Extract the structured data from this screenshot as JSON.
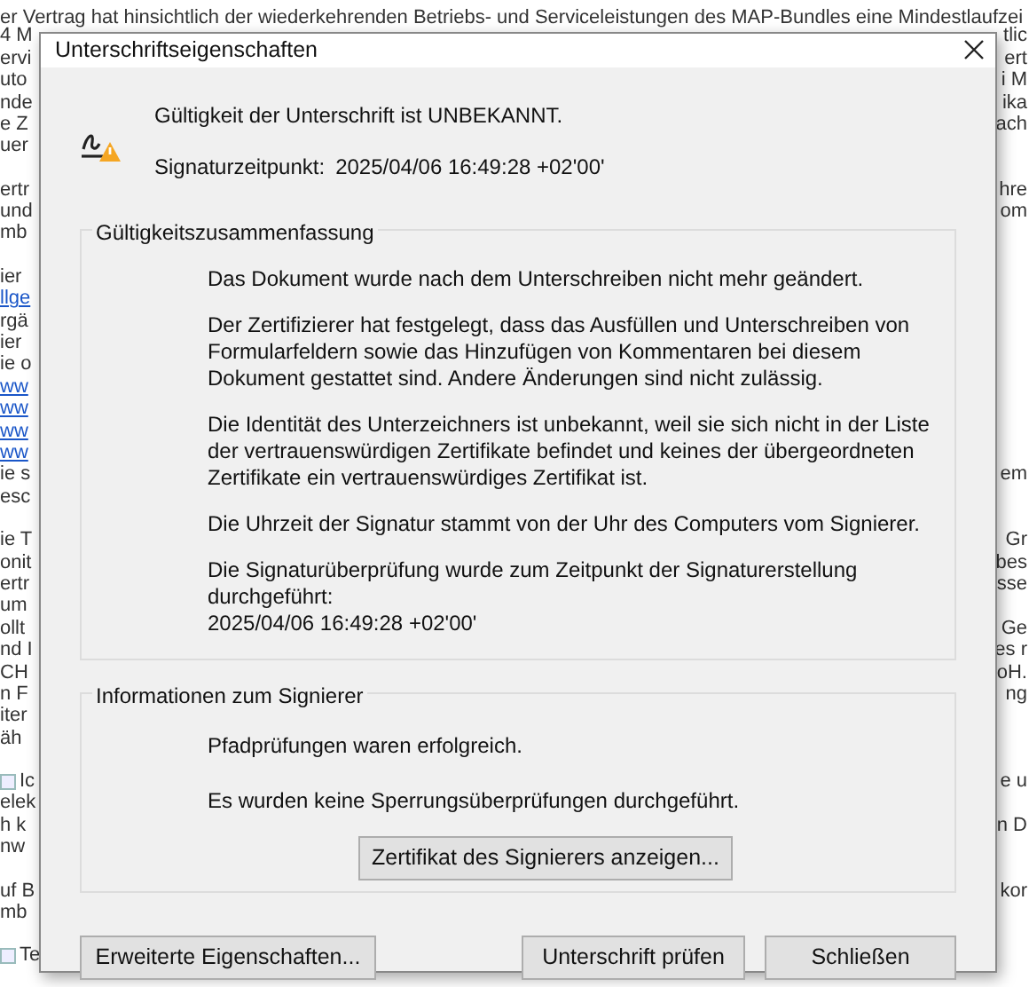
{
  "document": {
    "top_line": "er Vertrag hat hinsichtlich der wiederkehrenden Betriebs- und Serviceleistungen des MAP-Bundles eine Mindestlaufzei",
    "paragraphs": [
      {
        "lines": [
          {
            "left": "4 M",
            "right": "tlic"
          },
          {
            "left": "ervi",
            "right": "ert"
          },
          {
            "left": "uto",
            "right": "i M"
          },
          {
            "left": "nde",
            "right": "ika"
          },
          {
            "left": "e Z",
            "right": "ach"
          },
          {
            "left": "uer"
          }
        ]
      },
      {
        "lines": [
          {
            "left": "ertr",
            "right": "hre"
          },
          {
            "left": "und",
            "right": "om"
          },
          {
            "left": "mb"
          }
        ]
      },
      {
        "lines": [
          {
            "left": "ier"
          },
          {
            "left": "llge",
            "link": true
          },
          {
            "left": "rgä"
          },
          {
            "left": "ier"
          },
          {
            "left": "ie o"
          },
          {
            "left": "ww",
            "link": true
          },
          {
            "left": "ww",
            "link": true
          },
          {
            "left": "ww",
            "link": true
          },
          {
            "left": "ww",
            "link": true
          },
          {
            "left": "ie s",
            "right": "em"
          },
          {
            "left": "esc"
          }
        ]
      },
      {
        "lines": [
          {
            "left": "ie T",
            "right": "Gr"
          },
          {
            "left": "onit",
            "right": "bes"
          },
          {
            "left": "ertr",
            "right": "sse"
          },
          {
            "left": "um"
          },
          {
            "left": "ollt",
            "right": "Ge"
          },
          {
            "left": "nd I",
            "right": "es r"
          },
          {
            "left": "CH",
            "right": "oH."
          },
          {
            "left": "n F",
            "right": "ng"
          },
          {
            "left": "iter"
          },
          {
            "left": "äh"
          }
        ]
      },
      {
        "lines": [
          {
            "left": "Ic",
            "checkbox": false,
            "right": "e u"
          },
          {
            "left": "elek"
          },
          {
            "left": "h k",
            "right": "n D"
          },
          {
            "left": "nw"
          }
        ]
      },
      {
        "lines": [
          {
            "left": "uf B",
            "right": "kor"
          },
          {
            "left": "mb"
          }
        ]
      },
      {
        "lines": [
          {
            "left": "Te",
            "checkbox": false
          }
        ]
      }
    ]
  },
  "dialog": {
    "title": "Unterschriftseigenschaften",
    "status": "Gültigkeit der Unterschrift ist UNBEKANNT.",
    "timestamp_label": "Signaturzeitpunkt:",
    "timestamp": "2025/04/06 16:49:28 +02'00'",
    "summary": {
      "title": "Gültigkeitszusammenfassung",
      "paragraphs": [
        "Das Dokument wurde nach dem Unterschreiben nicht mehr geändert.",
        "Der Zertifizierer hat festgelegt, dass das Ausfüllen und Unterschreiben von Formularfeldern sowie das Hinzufügen von Kommentaren bei diesem Dokument gestattet sind. Andere Änderungen sind nicht zulässig.",
        "Die Identität des Unterzeichners ist unbekannt, weil sie sich nicht in der Liste der vertrauenswürdigen Zertifikate befindet und keines der übergeordneten Zertifikate ein vertrauenswürdiges Zertifikat ist.",
        "Die Uhrzeit der Signatur stammt von der Uhr des Computers vom Signierer.",
        "Die Signaturüberprüfung wurde zum Zeitpunkt der Signaturerstellung durchgeführt:\n2025/04/06 16:49:28 +02'00'"
      ]
    },
    "signer": {
      "title": "Informationen zum Signierer",
      "lines": [
        "Pfadprüfungen waren erfolgreich.",
        "Es wurden keine Sperrungsüberprüfungen durchgeführt."
      ],
      "button": "Zertifikat des Signierers anzeigen..."
    },
    "buttons": [
      "Erweiterte Eigenschaften...",
      "Unterschrift prüfen",
      "Schließen"
    ]
  }
}
